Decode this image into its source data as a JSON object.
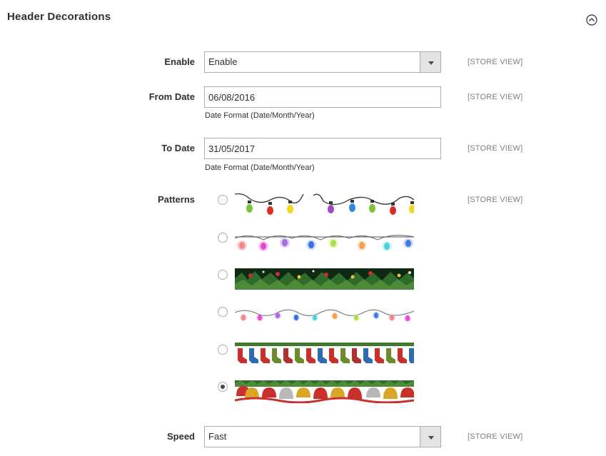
{
  "section": {
    "title": "Header Decorations",
    "collapse_icon": "collapse-circle-chevron-up-icon"
  },
  "enable": {
    "label": "Enable",
    "value": "Enable",
    "scope": "[STORE VIEW]"
  },
  "from_date": {
    "label": "From Date",
    "value": "06/08/2016",
    "note": "Date Format (Date/Month/Year)",
    "scope": "[STORE VIEW]"
  },
  "to_date": {
    "label": "To Date",
    "value": "31/05/2017",
    "note": "Date Format (Date/Month/Year)",
    "scope": "[STORE VIEW]"
  },
  "patterns": {
    "label": "Patterns",
    "scope": "[STORE VIEW]",
    "selected_index": 5,
    "items": [
      {
        "name": "colored-bulb-lights"
      },
      {
        "name": "glowing-bulb-lights"
      },
      {
        "name": "pine-garland"
      },
      {
        "name": "small-glowing-lights"
      },
      {
        "name": "christmas-stockings"
      },
      {
        "name": "christmas-bells"
      }
    ]
  },
  "speed": {
    "label": "Speed",
    "value": "Fast",
    "scope": "[STORE VIEW]"
  },
  "colors": {
    "border": "#adadad",
    "text": "#303030",
    "scope_text": "#808080",
    "select_button": "#e3e3e3"
  }
}
